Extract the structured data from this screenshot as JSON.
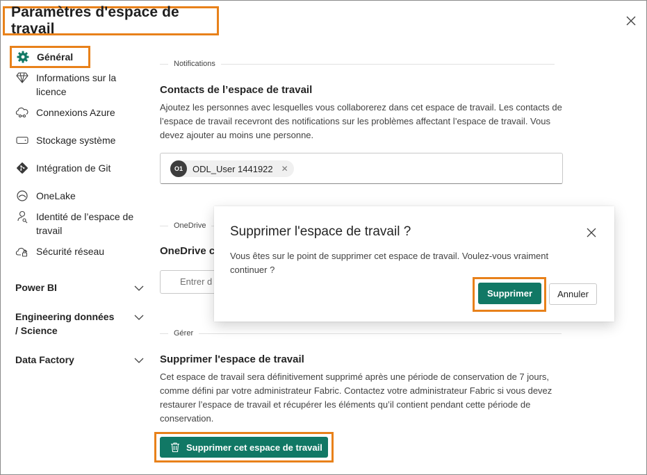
{
  "header": {
    "title": "Paramètres d'espace de travail"
  },
  "sidebar": {
    "items": [
      {
        "label": "Général",
        "icon": "gear-icon",
        "selected": true
      },
      {
        "label": "Informations sur la licence",
        "icon": "diamond-icon"
      },
      {
        "label": "Connexions Azure",
        "icon": "cloud-link-icon"
      },
      {
        "label": "Stockage système",
        "icon": "storage-icon"
      },
      {
        "label": "Intégration de Git",
        "icon": "git-icon"
      },
      {
        "label": "OneLake",
        "icon": "onelake-icon"
      },
      {
        "label": "Identité de l’espace de travail",
        "icon": "identity-icon"
      },
      {
        "label": "Sécurité réseau",
        "icon": "cloud-lock-icon"
      }
    ],
    "groups": [
      {
        "label": "Power BI"
      },
      {
        "label": "Engineering données / Science"
      },
      {
        "label": "Data Factory"
      }
    ]
  },
  "main": {
    "notifications": {
      "section_label": "Notifications",
      "heading": "Contacts de l’espace de travail",
      "description": "Ajoutez les personnes avec lesquelles vous collaborerez dans cet espace de travail. Les contacts de l’espace de travail recevront des notifications sur les problèmes affectant l’espace de travail. Vous devez ajouter au moins une personne.",
      "contact": {
        "initials": "O1",
        "name": "ODL_User 1441922"
      }
    },
    "onedrive": {
      "section_label": "OneDrive",
      "heading": "OneDrive c",
      "placeholder": "Entrer d"
    },
    "manage": {
      "section_label": "Gérer",
      "heading": "Supprimer l'espace de travail",
      "description": "Cet espace de travail sera définitivement supprimé après une période de conservation de 7 jours, comme défini par votre administrateur Fabric. Contactez votre administrateur Fabric si vous devez restaurer l’espace de travail et récupérer les éléments qu’il contient pendant cette période de conservation.",
      "delete_button": "Supprimer cet espace de travail"
    }
  },
  "dialog": {
    "title": "Supprimer l'espace de travail ?",
    "message": "Vous êtes sur le point de supprimer cet espace de travail. Voulez-vous vraiment continuer ?",
    "confirm_label": "Supprimer",
    "cancel_label": "Annuler"
  },
  "colors": {
    "accent": "#117865",
    "highlight": "#e8811a"
  }
}
